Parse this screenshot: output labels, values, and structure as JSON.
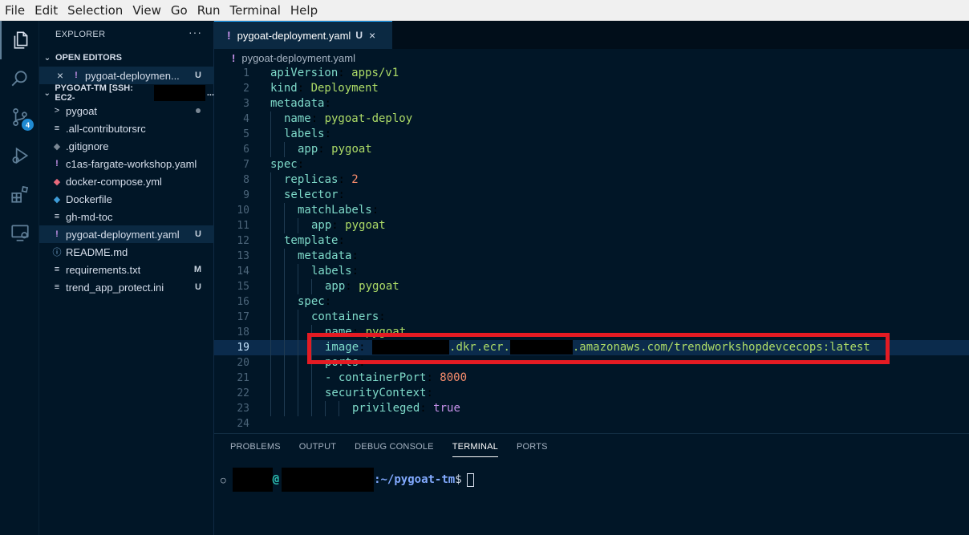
{
  "menu": [
    "File",
    "Edit",
    "Selection",
    "View",
    "Go",
    "Run",
    "Terminal",
    "Help"
  ],
  "activity": {
    "scm_badge": "4"
  },
  "sidebar": {
    "title": "EXPLORER",
    "more": "···",
    "open_editors_label": "OPEN EDITORS",
    "open_editor": {
      "name": "pygoat-deploymen...",
      "status": "U"
    },
    "workspace_label": "PYGOAT-TM [SSH: EC2-",
    "workspace_suffix": "...",
    "files": [
      {
        "name": "pygoat",
        "icon": ">",
        "status": ""
      },
      {
        "name": ".all-contributorsrc",
        "icon": "≡",
        "status": ""
      },
      {
        "name": ".gitignore",
        "icon": "◆",
        "status": ""
      },
      {
        "name": "c1as-fargate-workshop.yaml",
        "icon": "!",
        "status": ""
      },
      {
        "name": "docker-compose.yml",
        "icon": "🐳",
        "status": ""
      },
      {
        "name": "Dockerfile",
        "icon": "🐳",
        "status": ""
      },
      {
        "name": "gh-md-toc",
        "icon": "≡",
        "status": ""
      },
      {
        "name": "pygoat-deployment.yaml",
        "icon": "!",
        "status": "U"
      },
      {
        "name": "README.md",
        "icon": "ⓘ",
        "status": ""
      },
      {
        "name": "requirements.txt",
        "icon": "≡",
        "status": "M"
      },
      {
        "name": "trend_app_protect.ini",
        "icon": "≡",
        "status": "U"
      }
    ]
  },
  "tab": {
    "name": "pygoat-deployment.yaml",
    "status": "U",
    "close": "×"
  },
  "breadcrumb": "pygoat-deployment.yaml",
  "editor": {
    "lines": [
      {
        "n": "1"
      },
      {
        "n": "2"
      },
      {
        "n": "3"
      },
      {
        "n": "4"
      },
      {
        "n": "5"
      },
      {
        "n": "6"
      },
      {
        "n": "7"
      },
      {
        "n": "8"
      },
      {
        "n": "9"
      },
      {
        "n": "10"
      },
      {
        "n": "11"
      },
      {
        "n": "12"
      },
      {
        "n": "13"
      },
      {
        "n": "14"
      },
      {
        "n": "15"
      },
      {
        "n": "16"
      },
      {
        "n": "17"
      },
      {
        "n": "18"
      },
      {
        "n": "19"
      },
      {
        "n": "20"
      },
      {
        "n": "21"
      },
      {
        "n": "22"
      },
      {
        "n": "23"
      },
      {
        "n": "24"
      }
    ],
    "code": {
      "l1k": "apiVersion",
      "l1v": "apps/v1",
      "l2k": "kind",
      "l2v": "Deployment",
      "l3k": "metadata",
      "l4k": "name",
      "l4v": "pygoat-deploy",
      "l5k": "labels",
      "l6k": "app",
      "l6v": "pygoat",
      "l7k": "spec",
      "l8k": "replicas",
      "l8v": "2",
      "l9k": "selector",
      "l10k": "matchLabels",
      "l11k": "app",
      "l11v": "pygoat",
      "l12k": "template",
      "l13k": "metadata",
      "l14k": "labels",
      "l15k": "app",
      "l15v": "pygoat",
      "l16k": "spec",
      "l17k": "containers",
      "l18k": "name",
      "l18v": "pygoat",
      "l19k": "image",
      "l19v1": ".dkr.ecr.",
      "l19v2": ".amazonaws.com/trendworkshopdevcecops:latest",
      "l20k": "ports",
      "l21k": "containerPort",
      "l21v": "8000",
      "l22k": "securityContext",
      "l23k": "privileged",
      "l23v": "true"
    }
  },
  "panel": {
    "tabs": [
      "PROBLEMS",
      "OUTPUT",
      "DEBUG CONSOLE",
      "TERMINAL",
      "PORTS"
    ],
    "active_tab": "TERMINAL",
    "prompt_at": "@",
    "prompt_path": ":~/pygoat-tm",
    "prompt_symbol": "$"
  }
}
